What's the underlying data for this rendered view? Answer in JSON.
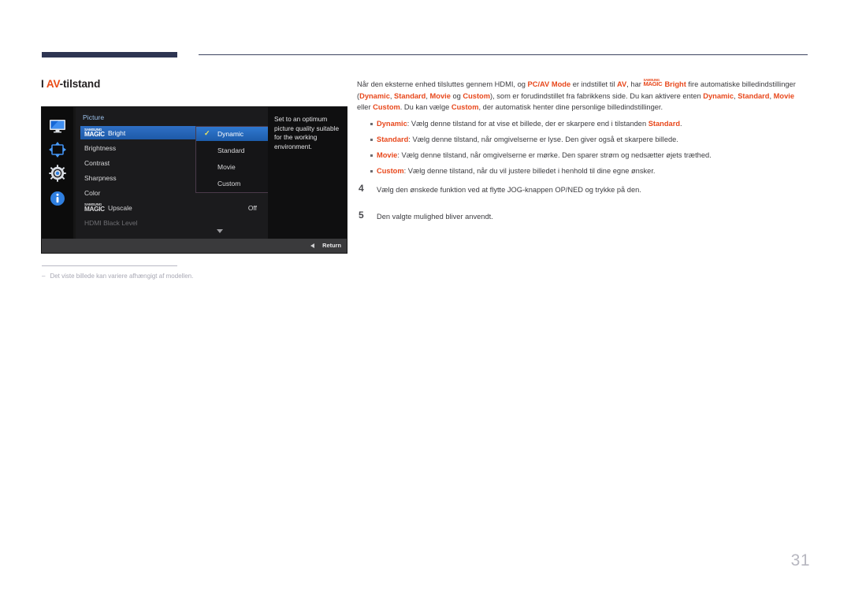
{
  "page": {
    "number": "31",
    "section_title": {
      "prefix": "I",
      "accent": "AV",
      "rest": "-tilstand"
    }
  },
  "osd": {
    "menu_title": "Picture",
    "rail_icons": [
      {
        "name": "monitor-icon",
        "label": "Picture"
      },
      {
        "name": "screen-adjust-icon",
        "label": "Display"
      },
      {
        "name": "gear-icon",
        "label": "System"
      },
      {
        "name": "info-icon",
        "label": "Information"
      }
    ],
    "rows": [
      {
        "label": "Bright",
        "logo_line1": "SAMSUNG",
        "logo_line2": "MAGIC",
        "value": "",
        "selected": true,
        "dim": false,
        "has_logo": true
      },
      {
        "label": "Brightness",
        "value": "",
        "selected": false,
        "dim": false,
        "has_logo": false
      },
      {
        "label": "Contrast",
        "value": "",
        "selected": false,
        "dim": false,
        "has_logo": false
      },
      {
        "label": "Sharpness",
        "value": "",
        "selected": false,
        "dim": false,
        "has_logo": false
      },
      {
        "label": "Color",
        "value": "",
        "selected": false,
        "dim": false,
        "has_logo": false
      },
      {
        "label": "Upscale",
        "logo_line1": "SAMSUNG",
        "logo_line2": "MAGIC",
        "value": "Off",
        "selected": false,
        "dim": false,
        "has_logo": true
      },
      {
        "label": "HDMI Black Level",
        "value": "",
        "selected": false,
        "dim": true,
        "has_logo": false
      }
    ],
    "submenu": [
      {
        "label": "Dynamic",
        "checked": true,
        "selected": true
      },
      {
        "label": "Standard",
        "checked": false,
        "selected": false
      },
      {
        "label": "Movie",
        "checked": false,
        "selected": false
      },
      {
        "label": "Custom",
        "checked": false,
        "selected": false
      }
    ],
    "help_text": "Set to an optimum picture quality suitable for the working environment.",
    "footer": {
      "return_label": "Return"
    }
  },
  "footnote": {
    "dash": "–",
    "text": "Det viste billede kan variere afhængigt af modellen."
  },
  "body": {
    "paragraph": {
      "p1": "Når den eksterne enhed tilsluttes gennem HDMI, og ",
      "bold1": "PC/AV Mode",
      "p2": " er indstillet til ",
      "bold2": "AV",
      "p3": ", har ",
      "logo_line1": "SAMSUNG",
      "logo_line2": "MAGIC",
      "logo_suffix": "Bright",
      "p4": " fire automatiske billedindstillinger (",
      "opt1": "Dynamic",
      "sep1": ", ",
      "opt2": "Standard",
      "sep2": ", ",
      "opt3": "Movie",
      "sep3": " og ",
      "opt4": "Custom",
      "p5": "), som er forudindstillet fra fabrikkens side. Du kan aktivere enten ",
      "opt5": "Dynamic",
      "sep4": ", ",
      "opt6": "Standard",
      "sep5": ", ",
      "opt7": "Movie",
      "sep6": " eller ",
      "opt8": "Custom",
      "p6": ". Du kan vælge ",
      "opt9": "Custom",
      "p7": ", der automatisk henter dine personlige billedindstillinger."
    },
    "bullets": [
      {
        "term": "Dynamic",
        "text_before": ": Vælg denne tilstand for at vise et billede, der er skarpere end i tilstanden ",
        "term2": "Standard",
        "text_after": "."
      },
      {
        "term": "Standard",
        "text_before": ": Vælg denne tilstand, når omgivelserne er lyse. Den giver også et skarpere billede.",
        "term2": "",
        "text_after": ""
      },
      {
        "term": "Movie",
        "text_before": ": Vælg denne tilstand, når omgivelserne er mørke. Den sparer strøm og nedsætter øjets træthed.",
        "term2": "",
        "text_after": ""
      },
      {
        "term": "Custom",
        "text_before": ": Vælg denne tilstand, når du vil justere billedet i henhold til dine egne ønsker.",
        "term2": "",
        "text_after": ""
      }
    ],
    "steps": [
      {
        "num": "4",
        "text": "Vælg den ønskede funktion ved at flytte JOG-knappen OP/NED og trykke på den."
      },
      {
        "num": "5",
        "text": "Den valgte mulighed bliver anvendt."
      }
    ]
  },
  "colors": {
    "accent_red": "#e8481c",
    "header_navy": "#2e3552",
    "osd_select_blue": "#2f6fc4",
    "osd_check_yellow": "#f3e85b"
  }
}
